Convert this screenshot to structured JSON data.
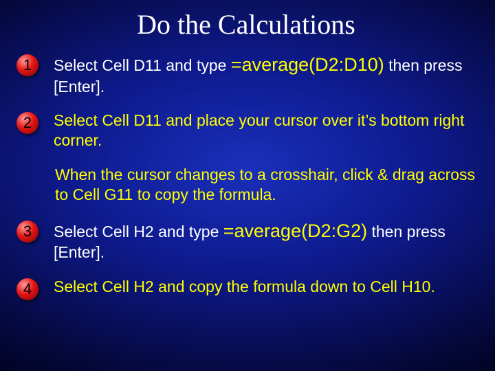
{
  "title": "Do the Calculations",
  "steps": {
    "s1": {
      "num": "1",
      "pre": "Select Cell D11 and type ",
      "formula": "=average(D2:D10)",
      "post": " then press [Enter]."
    },
    "s2": {
      "num": "2",
      "text": "Select Cell D11 and place your cursor over it’s bottom right corner."
    },
    "note": {
      "text": "When the cursor changes to a crosshair, click & drag across to Cell G11 to copy the formula."
    },
    "s3": {
      "num": "3",
      "pre": "Select Cell H2 and type  ",
      "formula": "=average(D2:G2)",
      "post": " then press [Enter]."
    },
    "s4": {
      "num": "4",
      "text": "Select Cell H2 and copy the formula down to Cell H10."
    }
  }
}
